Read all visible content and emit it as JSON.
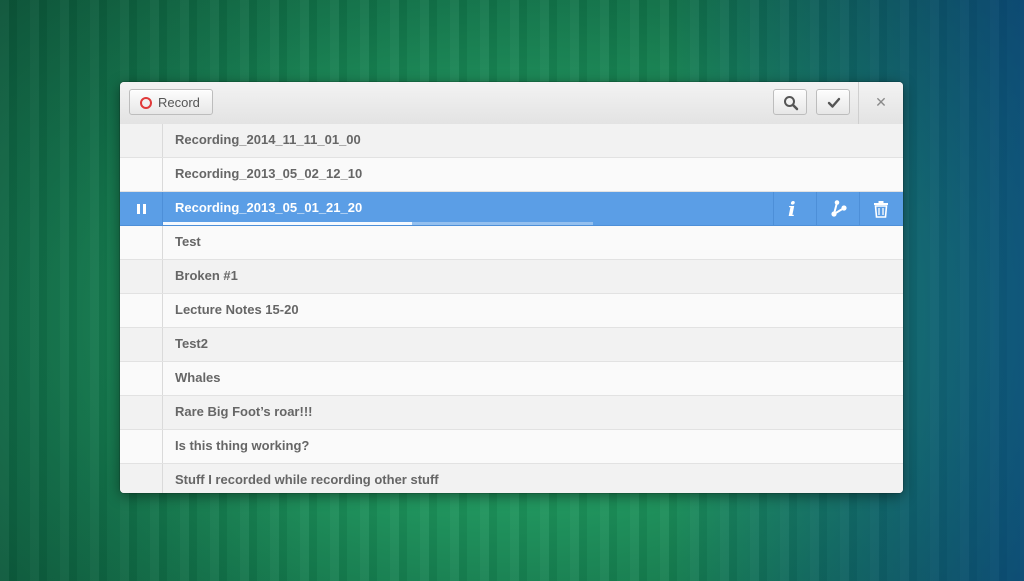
{
  "toolbar": {
    "record_label": "Record",
    "search_icon": "search-icon",
    "check_icon": "checkmark-icon",
    "close_symbol": "✕"
  },
  "colors": {
    "accent": "#5b9ee6",
    "record": "#e03a3a"
  },
  "recordings": [
    {
      "name": "Recording_2014_11_11_01_00"
    },
    {
      "name": "Recording_2013_05_02_12_10"
    },
    {
      "name": "Recording_2013_05_01_21_20",
      "selected": true,
      "state": "playing",
      "progress_fraction": 0.58
    },
    {
      "name": "Test"
    },
    {
      "name": "Broken #1"
    },
    {
      "name": "Lecture Notes 15-20"
    },
    {
      "name": "Test2"
    },
    {
      "name": "Whales"
    },
    {
      "name": "Rare Big Foot’s roar!!!"
    },
    {
      "name": "Is this thing working?"
    },
    {
      "name": "Stuff I recorded while recording other stuff"
    }
  ],
  "selected_actions": [
    "info-icon",
    "share-icon",
    "trash-icon"
  ]
}
